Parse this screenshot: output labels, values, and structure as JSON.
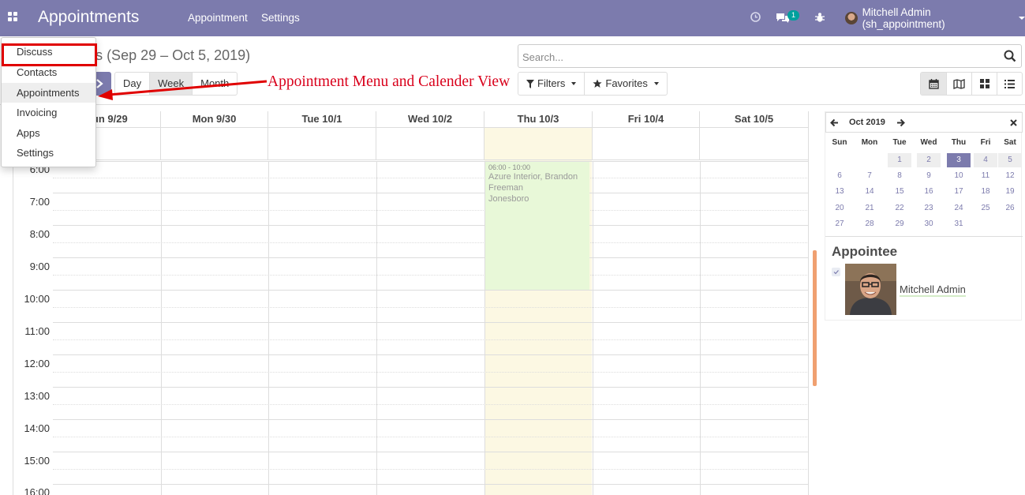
{
  "navbar": {
    "title": "Appointments",
    "menu": [
      "Appointment",
      "Settings"
    ],
    "chat_badge": "1",
    "user": "Mitchell Admin (sh_appointment)"
  },
  "breadcrumb": "Appointments (Sep 29 – Oct 5, 2019)",
  "search": {
    "placeholder": "Search..."
  },
  "scale": {
    "day": "Day",
    "week": "Week",
    "month": "Month",
    "active": "week"
  },
  "filters": {
    "filters_label": "Filters",
    "favorites_label": "Favorites"
  },
  "views": [
    {
      "icon": "calendar-icon",
      "active": true
    },
    {
      "icon": "map-icon",
      "active": false
    },
    {
      "icon": "kanban-icon",
      "active": false
    },
    {
      "icon": "list-icon",
      "active": false
    }
  ],
  "annotation": "Appointment Menu and Calender View",
  "calendar": {
    "days": [
      "Sun 9/29",
      "Mon 9/30",
      "Tue 10/1",
      "Wed 10/2",
      "Thu 10/3",
      "Fri 10/4",
      "Sat 10/5"
    ],
    "today_index": 4,
    "hours": [
      "6:00",
      "7:00",
      "8:00",
      "9:00",
      "10:00",
      "11:00",
      "12:00",
      "13:00",
      "14:00",
      "15:00",
      "16:00"
    ],
    "event": {
      "time": "06:00 - 10:00",
      "title": "Azure Interior, Brandon Freeman",
      "location": "Jonesboro"
    }
  },
  "datepicker": {
    "month": "Oct 2019",
    "day_names": [
      "Sun",
      "Mon",
      "Tue",
      "Wed",
      "Thu",
      "Fri",
      "Sat"
    ],
    "weeks": [
      [
        "",
        "",
        "1",
        "2",
        "3",
        "4",
        "5"
      ],
      [
        "6",
        "7",
        "8",
        "9",
        "10",
        "11",
        "12"
      ],
      [
        "13",
        "14",
        "15",
        "16",
        "17",
        "18",
        "19"
      ],
      [
        "20",
        "21",
        "22",
        "23",
        "24",
        "25",
        "26"
      ],
      [
        "27",
        "28",
        "29",
        "30",
        "31",
        "",
        ""
      ]
    ],
    "selected": "3"
  },
  "appointee": {
    "title": "Appointee",
    "name": "Mitchell Admin"
  },
  "app_menu": {
    "items": [
      "Discuss",
      "Contacts",
      "Appointments",
      "Invoicing",
      "Apps",
      "Settings"
    ],
    "active": "Appointments"
  },
  "colors": {
    "brand": "#7c7bad",
    "today": "#fcf8e3",
    "event": "#e8f8d8",
    "highlight": "#e00000"
  }
}
